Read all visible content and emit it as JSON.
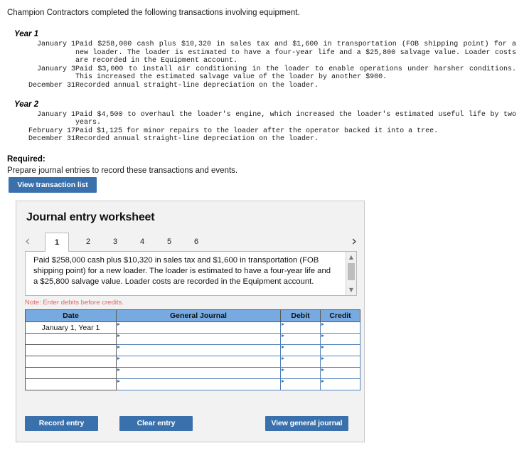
{
  "intro": {
    "statement": "Champion Contractors completed the following transactions involving equipment."
  },
  "years": [
    {
      "heading": "Year 1",
      "transactions": [
        {
          "date": "January 1",
          "description": "Paid $258,000 cash plus $10,320 in sales tax and $1,600 in transportation (FOB shipping point) for a new loader. The loader is estimated to have a four-year life and a $25,800 salvage value. Loader costs are recorded in the Equipment account."
        },
        {
          "date": "January 3",
          "description": "Paid $3,000 to install air conditioning in the loader to enable operations under harsher conditions. This increased the estimated salvage value of the loader by another $900."
        },
        {
          "date": "December 31",
          "description": "Recorded annual straight-line depreciation on the loader."
        }
      ]
    },
    {
      "heading": "Year 2",
      "transactions": [
        {
          "date": "January 1",
          "description": "Paid $4,500 to overhaul the loader's engine, which increased the loader's estimated useful life by two years."
        },
        {
          "date": "February 17",
          "description": "Paid $1,125 for minor repairs to the loader after the operator backed it into a tree."
        },
        {
          "date": "December 31",
          "description": "Recorded annual straight-line depreciation on the loader."
        }
      ]
    }
  ],
  "required": {
    "heading": "Required:",
    "body": "Prepare journal entries to record these transactions and events."
  },
  "buttons": {
    "view_transaction_list": "View transaction list",
    "record_entry": "Record entry",
    "clear_entry": "Clear entry",
    "view_general_journal": "View general journal"
  },
  "worksheet": {
    "title": "Journal entry worksheet",
    "prev_arrow": "‹",
    "next_arrow": "›",
    "tabs": [
      "1",
      "2",
      "3",
      "4",
      "5",
      "6"
    ],
    "active_tab": "1",
    "description": "Paid $258,000 cash plus $10,320 in sales tax and $1,600 in transportation (FOB shipping point) for a new loader. The loader is estimated to have a four-year life and a $25,800 salvage value. Loader costs are recorded in the Equipment account.",
    "scrollbar": {
      "up_glyph": "▲",
      "down_glyph": "▼"
    },
    "note": "Note: Enter debits before credits.",
    "table": {
      "headers": [
        "Date",
        "General Journal",
        "Debit",
        "Credit"
      ],
      "rows": [
        {
          "date": "January 1, Year 1",
          "general_journal": "",
          "debit": "",
          "credit": ""
        },
        {
          "date": "",
          "general_journal": "",
          "debit": "",
          "credit": ""
        },
        {
          "date": "",
          "general_journal": "",
          "debit": "",
          "credit": ""
        },
        {
          "date": "",
          "general_journal": "",
          "debit": "",
          "credit": ""
        },
        {
          "date": "",
          "general_journal": "",
          "debit": "",
          "credit": ""
        },
        {
          "date": "",
          "general_journal": "",
          "debit": "",
          "credit": ""
        }
      ]
    }
  },
  "colors": {
    "accent_blue": "#3a71ac",
    "header_blue": "#76aae0",
    "note_red": "#e06666",
    "panel_gray": "#f2f2f2"
  }
}
